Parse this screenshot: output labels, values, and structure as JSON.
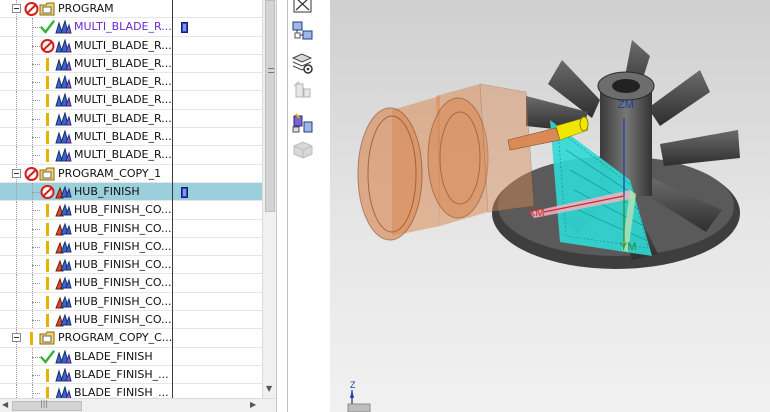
{
  "navigator": {
    "rows": [
      {
        "label": "PROGRAM",
        "level": 0,
        "status": "no-entry-icon",
        "type": "program-group-icon",
        "has_expander": true
      },
      {
        "label": "MULTI_BLADE_R...",
        "level": 1,
        "status": "complete-checkmark-icon",
        "type": "multi-blade-operation-icon",
        "highlight": true,
        "path_icon": "toolpath-generated-icon"
      },
      {
        "label": "MULTI_BLADE_R...",
        "level": 1,
        "status": "no-entry-icon",
        "type": "multi-blade-operation-icon"
      },
      {
        "label": "MULTI_BLADE_R...",
        "level": 1,
        "status": "needs-regeneration-icon",
        "type": "multi-blade-operation-icon"
      },
      {
        "label": "MULTI_BLADE_R...",
        "level": 1,
        "status": "needs-regeneration-icon",
        "type": "multi-blade-operation-icon"
      },
      {
        "label": "MULTI_BLADE_R...",
        "level": 1,
        "status": "needs-regeneration-icon",
        "type": "multi-blade-operation-icon"
      },
      {
        "label": "MULTI_BLADE_R...",
        "level": 1,
        "status": "needs-regeneration-icon",
        "type": "multi-blade-operation-icon"
      },
      {
        "label": "MULTI_BLADE_R...",
        "level": 1,
        "status": "needs-regeneration-icon",
        "type": "multi-blade-operation-icon"
      },
      {
        "label": "MULTI_BLADE_R...",
        "level": 1,
        "status": "needs-regeneration-icon",
        "type": "multi-blade-operation-icon"
      },
      {
        "label": "PROGRAM_COPY_1",
        "level": 0,
        "status": "no-entry-icon",
        "type": "program-group-icon",
        "has_expander": true
      },
      {
        "label": "HUB_FINISH",
        "level": 1,
        "status": "no-entry-icon",
        "type": "hub-finish-operation-icon",
        "selected": true,
        "path_icon": "toolpath-generated-icon"
      },
      {
        "label": "HUB_FINISH_CO...",
        "level": 1,
        "status": "needs-regeneration-icon",
        "type": "hub-finish-operation-icon"
      },
      {
        "label": "HUB_FINISH_CO...",
        "level": 1,
        "status": "needs-regeneration-icon",
        "type": "hub-finish-operation-icon"
      },
      {
        "label": "HUB_FINISH_CO...",
        "level": 1,
        "status": "needs-regeneration-icon",
        "type": "hub-finish-operation-icon"
      },
      {
        "label": "HUB_FINISH_CO...",
        "level": 1,
        "status": "needs-regeneration-icon",
        "type": "hub-finish-operation-icon"
      },
      {
        "label": "HUB_FINISH_CO...",
        "level": 1,
        "status": "needs-regeneration-icon",
        "type": "hub-finish-operation-icon"
      },
      {
        "label": "HUB_FINISH_CO...",
        "level": 1,
        "status": "needs-regeneration-icon",
        "type": "hub-finish-operation-icon"
      },
      {
        "label": "HUB_FINISH_CO...",
        "level": 1,
        "status": "needs-regeneration-icon",
        "type": "hub-finish-operation-icon"
      },
      {
        "label": "PROGRAM_COPY_C...",
        "level": 0,
        "status": "needs-regeneration-icon",
        "type": "program-group-icon",
        "has_expander": true
      },
      {
        "label": "BLADE_FINISH",
        "level": 1,
        "status": "complete-checkmark-icon",
        "type": "blade-finish-operation-icon"
      },
      {
        "label": "BLADE_FINISH_...",
        "level": 1,
        "status": "needs-regeneration-icon",
        "type": "blade-finish-operation-icon"
      },
      {
        "label": "BLADE_FINISH_...",
        "level": 1,
        "status": "needs-regeneration-icon",
        "type": "blade-finish-operation-icon"
      }
    ],
    "horizontal_scroll_grip": "|||"
  },
  "resource_bar": {
    "buttons": [
      {
        "name": "close-view-icon"
      },
      {
        "name": "assembly-navigator-icon"
      },
      {
        "name": "part-navigator-gear-icon"
      },
      {
        "name": "constraint-navigator-icon"
      },
      {
        "name": "operation-navigator-icon"
      },
      {
        "name": "history-cube-icon"
      }
    ]
  },
  "viewport": {
    "axis_labels": {
      "zm": "ZM",
      "xm": "XM",
      "ym": "YM"
    },
    "triad_label": "Z",
    "colors": {
      "tool_holder": "#d98a56",
      "impeller": "#555555",
      "toolpath": "#2fd9d6",
      "tool_tip": "#f2e600"
    }
  },
  "colors": {
    "selected_row": "#9bcfdc",
    "highlight_text": "#6a2bd0",
    "complete": "#33b233",
    "no_entry": "#d41e1e",
    "needs_regen": "#e6b400"
  }
}
